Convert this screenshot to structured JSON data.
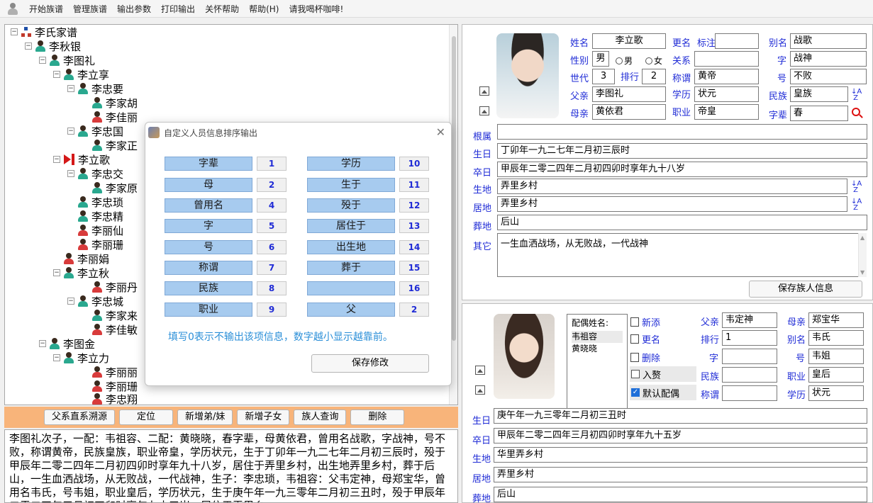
{
  "menu": [
    "开始族谱",
    "管理族谱",
    "输出参数",
    "打印输出",
    "关怀帮助",
    "帮助(H)",
    "请我喝杯咖啡!"
  ],
  "tree": [
    {
      "label": "李氏家谱",
      "gender": "root",
      "exp": "−"
    },
    {
      "label": "李秋银",
      "gender": "male",
      "exp": "−"
    },
    {
      "label": "李图礼",
      "gender": "male",
      "exp": "−"
    },
    {
      "label": "李立享",
      "gender": "male",
      "exp": "−"
    },
    {
      "label": "李忠要",
      "gender": "male",
      "exp": "−"
    },
    {
      "label": "李家胡",
      "gender": "male",
      "exp": ""
    },
    {
      "label": "李佳丽",
      "gender": "female",
      "exp": ""
    },
    {
      "label": "李忠国",
      "gender": "male",
      "exp": "−"
    },
    {
      "label": "李家正",
      "gender": "male",
      "exp": ""
    },
    {
      "label": "李立歌",
      "gender": "selected",
      "exp": "−"
    },
    {
      "label": "李忠交",
      "gender": "male",
      "exp": "−"
    },
    {
      "label": "李家原",
      "gender": "male",
      "exp": ""
    },
    {
      "label": "李忠琐",
      "gender": "male",
      "exp": ""
    },
    {
      "label": "李忠精",
      "gender": "male",
      "exp": ""
    },
    {
      "label": "李丽仙",
      "gender": "female",
      "exp": ""
    },
    {
      "label": "李丽珊",
      "gender": "female",
      "exp": ""
    },
    {
      "label": "李丽娟",
      "gender": "female",
      "exp": ""
    },
    {
      "label": "李立秋",
      "gender": "male",
      "exp": "−"
    },
    {
      "label": "李丽丹",
      "gender": "female",
      "exp": ""
    },
    {
      "label": "李忠城",
      "gender": "male",
      "exp": "−"
    },
    {
      "label": "李家来",
      "gender": "male",
      "exp": ""
    },
    {
      "label": "李佳敏",
      "gender": "female",
      "exp": ""
    },
    {
      "label": "李图金",
      "gender": "male",
      "exp": "−"
    },
    {
      "label": "李立力",
      "gender": "male",
      "exp": "−"
    },
    {
      "label": "李丽丽",
      "gender": "female",
      "exp": ""
    },
    {
      "label": "李丽珊",
      "gender": "female",
      "exp": ""
    },
    {
      "label": "李忠翔",
      "gender": "female",
      "exp": ""
    }
  ],
  "toolbar": [
    "父系直系溯源",
    "定位",
    "新增弟/妹",
    "新增子女",
    "族人查询",
    "删除"
  ],
  "summary": "李图礼次子，一配：韦祖容、二配：黄晓晓，春字辈，母黄依君，曾用名战歌，字战神，号不败，称谓黄帝，民族皇族，职业帝皇，学历状元，生于丁卯年一九二七年二月初三辰时，殁于甲辰年二零二四年二月初四卯时享年九十八岁，居住于弄里乡村，出生地弄里乡村，葬于后山，一生血洒战场，从无败战，一代战神，生子：李忠琐，韦祖容：父韦定神，母郑宝华，曾用名韦氏，号韦姐，职业皇后，学历状元，生于庚午年一九三零年二月初三丑时，殁于甲辰年二零二四年三月初四卯时享年九十五岁，居住于弄里乡",
  "person": {
    "labels": {
      "name": "姓名",
      "rename": "更名",
      "mark": "标注",
      "alias": "别名",
      "gender": "性别",
      "male": "男",
      "female": "女",
      "relation": "关系",
      "zi": "字",
      "gen": "世代",
      "rank": "排行",
      "title": "称谓",
      "hao": "号",
      "father": "父亲",
      "edu": "学历",
      "ethnic": "民族",
      "mother": "母亲",
      "job": "职业",
      "zibei": "字辈",
      "root": "根属",
      "birth": "生日",
      "death": "卒日",
      "birthplace": "生地",
      "residence": "居地",
      "burial": "葬地",
      "other": "其它",
      "save": "保存族人信息"
    },
    "name": "李立歌",
    "alias": "战歌",
    "gender": "男",
    "zi": "战神",
    "gen": "3",
    "rank": "2",
    "title": "黄帝",
    "hao": "不败",
    "father": "李图礼",
    "edu": "状元",
    "ethnic": "皇族",
    "mother": "黄依君",
    "job": "帝皇",
    "zibei": "春",
    "birth": "丁卯年一九二七年二月初三辰时",
    "death": "甲辰年二零二四年二月初四卯时享年九十八岁",
    "birthplace": "弄里乡村",
    "residence": "弄里乡村",
    "burial": "后山",
    "other": "一生血洒战场，从无败战，一代战神"
  },
  "spouse": {
    "labels": {
      "list_title": "配偶姓名:",
      "add": "新添",
      "rename": "更名",
      "delete": "删除",
      "in_law": "入赘",
      "default": "默认配偶",
      "father": "父亲",
      "mother": "母亲",
      "rank": "排行",
      "alias": "别名",
      "zi": "字",
      "hao": "号",
      "ethnic": "民族",
      "job": "职业",
      "title": "称谓",
      "edu": "学历",
      "birth": "生日",
      "death": "卒日",
      "birthplace": "生地",
      "residence": "居地",
      "burial": "葬地"
    },
    "list": [
      "韦祖容",
      "黄晓晓"
    ],
    "father": "韦定神",
    "mother": "郑宝华",
    "rank": "1",
    "alias": "韦氏",
    "zi": "",
    "hao": "韦姐",
    "ethnic": "",
    "job": "皇后",
    "title": "",
    "edu": "状元",
    "birth": "庚午年一九三零年二月初三丑时",
    "death": "甲辰年二零二四年三月初四卯时享年九十五岁",
    "birthplace": "华里弄乡村",
    "residence": "弄里乡村",
    "burial": "后山"
  },
  "dialog": {
    "title": "自定义人员信息排序输出",
    "left": [
      {
        "name": "字辈",
        "num": "1"
      },
      {
        "name": "母",
        "num": "2"
      },
      {
        "name": "曾用名",
        "num": "4"
      },
      {
        "name": "字",
        "num": "5"
      },
      {
        "name": "号",
        "num": "6"
      },
      {
        "name": "称谓",
        "num": "7"
      },
      {
        "name": "民族",
        "num": "8"
      },
      {
        "name": "职业",
        "num": "9"
      }
    ],
    "right": [
      {
        "name": "学历",
        "num": "10"
      },
      {
        "name": "生于",
        "num": "11"
      },
      {
        "name": "殁于",
        "num": "12"
      },
      {
        "name": "居住于",
        "num": "13"
      },
      {
        "name": "出生地",
        "num": "14"
      },
      {
        "name": "葬于",
        "num": "15"
      },
      {
        "name": "",
        "num": "16"
      },
      {
        "name": "父",
        "num": "2"
      }
    ],
    "hint": "填写0表示不输出该项信息，数字越小显示越靠前。",
    "save": "保存修改"
  },
  "colors": {
    "label": "#1f2bd6",
    "toolbar_bg": "#f8b47a",
    "sort_name_bg": "#a7cbef",
    "hint": "#2b8fd8"
  }
}
